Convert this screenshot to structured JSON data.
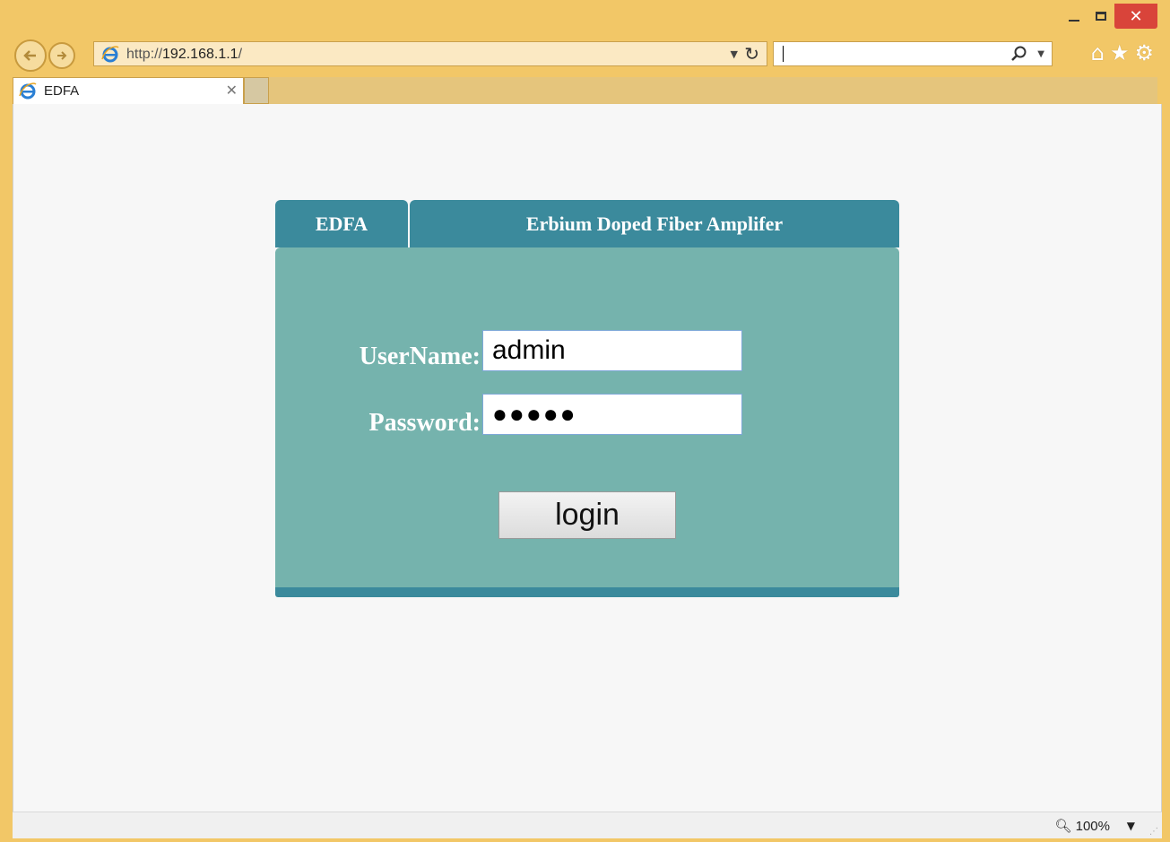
{
  "browser": {
    "url_prefix": "http://",
    "url_host": "192.168.1.1",
    "url_suffix": "/",
    "tab_title": "EDFA",
    "zoom": "100%",
    "icons": [
      "back-arrow-icon",
      "forward-arrow-icon",
      "ie-logo-icon",
      "refresh-icon",
      "search-icon",
      "home-icon",
      "favorites-star-icon",
      "settings-gear-icon",
      "close-icon",
      "minimize-icon",
      "maximize-icon"
    ]
  },
  "header": {
    "left": "EDFA",
    "right": "Erbium Doped Fiber Amplifer"
  },
  "form": {
    "username_label": "UserName:",
    "username_value": "admin",
    "password_label": "Password:",
    "password_masked": "●●●●●",
    "login_label": "login"
  },
  "colors": {
    "header": "#3b8a9c",
    "body": "#75b3ad",
    "window_frame": "#f2c767",
    "close_button": "#d9443a"
  }
}
